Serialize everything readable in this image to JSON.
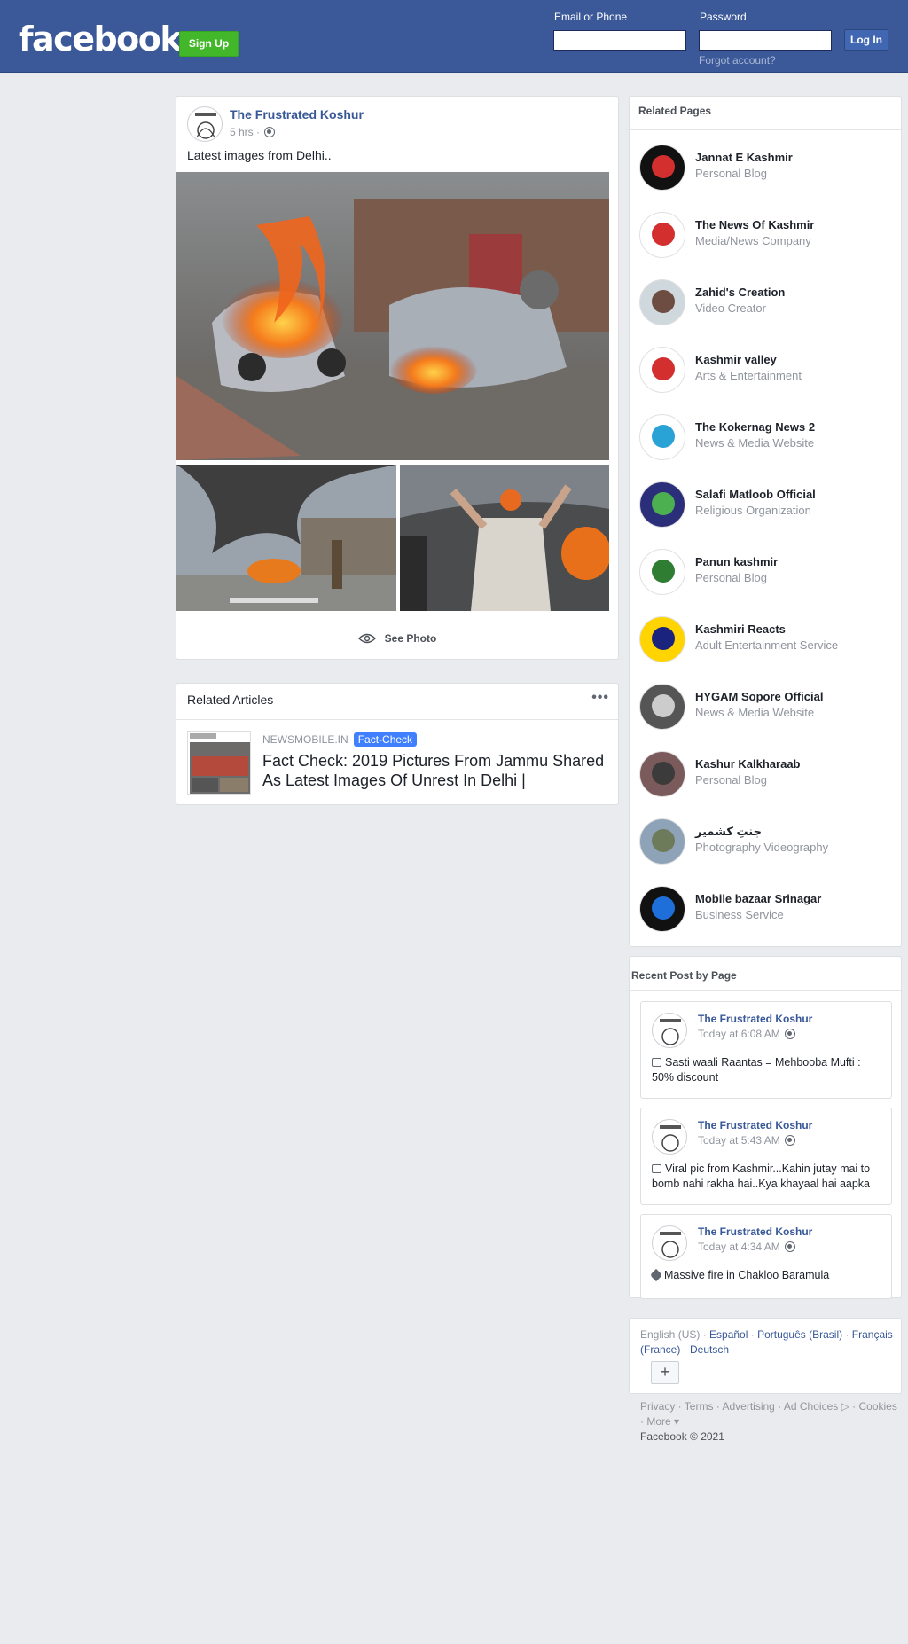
{
  "header": {
    "logo": "facebook",
    "signup_label": "Sign Up",
    "email_label": "Email or Phone",
    "password_label": "Password",
    "login_label": "Log In",
    "forgot_label": "Forgot account?"
  },
  "post": {
    "author": "The Frustrated Koshur",
    "time": "5 hrs ·",
    "text": "Latest images from Delhi..",
    "see_photo_label": "See Photo"
  },
  "related_articles": {
    "title": "Related Articles",
    "source": "NEWSMOBILE.IN",
    "badge": "Fact-Check",
    "headline": "Fact Check: 2019 Pictures From Jammu Shared As Latest Images Of Unrest In Delhi |"
  },
  "related_pages": {
    "title": "Related Pages",
    "items": [
      {
        "name": "Jannat E Kashmir",
        "category": "Personal Blog",
        "icon": "red-maple-leaf-logo"
      },
      {
        "name": "The News Of Kashmir",
        "category": "Media/News Company",
        "icon": "news-stamp-logo"
      },
      {
        "name": "Zahid's Creation",
        "category": "Video Creator",
        "icon": "portrait"
      },
      {
        "name": "Kashmir valley",
        "category": "Arts & Entertainment",
        "icon": "maple-leaf-logo"
      },
      {
        "name": "The Kokernag News 2",
        "category": "News & Media Website",
        "icon": "kn-logo"
      },
      {
        "name": "Salafi Matloob Official",
        "category": "Religious Organization",
        "icon": "emblem-logo"
      },
      {
        "name": "Panun kashmir",
        "category": "Personal Blog",
        "icon": "green-leaf-logo"
      },
      {
        "name": "Kashmiri Reacts",
        "category": "Adult Entertainment Service",
        "icon": "kr-logo"
      },
      {
        "name": "HYGAM Sopore Official",
        "category": "News & Media Website",
        "icon": "building-photo"
      },
      {
        "name": "Kashur Kalkharaab",
        "category": "Personal Blog",
        "icon": "group-photo"
      },
      {
        "name": "جنتِ کشمیر",
        "category": "Photography Videography",
        "icon": "landscape-photo"
      },
      {
        "name": "Mobile bazaar Srinagar",
        "category": "Business Service",
        "icon": "vk-logo"
      }
    ]
  },
  "recent_posts": {
    "title": "Recent Post by Page",
    "items": [
      {
        "author": "The Frustrated Koshur",
        "time": "Today at 6:08 AM",
        "text": "Sasti waali Raantas = Mehbooba Mufti : 50% discount",
        "icon": "photo-icon"
      },
      {
        "author": "The Frustrated Koshur",
        "time": "Today at 5:43 AM",
        "text": "Viral pic from Kashmir...Kahin jutay mai to bomb nahi rakha hai..Kya khayaal hai aapka",
        "icon": "photo-icon"
      },
      {
        "author": "The Frustrated Koshur",
        "time": "Today at 4:34 AM",
        "text": "Massive fire in Chakloo Baramula",
        "icon": "tag-icon"
      }
    ]
  },
  "languages": {
    "current": "English (US)",
    "others": [
      "Español",
      "Português (Brasil)",
      "Français (France)",
      "Deutsch"
    ],
    "more_button": "+"
  },
  "footer": {
    "links": [
      "Privacy",
      "Terms",
      "Advertising",
      "Ad Choices",
      "Cookies",
      "More"
    ],
    "copyright": "Facebook © 2021"
  },
  "colors": {
    "brand_blue": "#3b5998",
    "signup_green": "#42b72a",
    "link_blue": "#385898",
    "badge_blue": "#4080ff"
  }
}
